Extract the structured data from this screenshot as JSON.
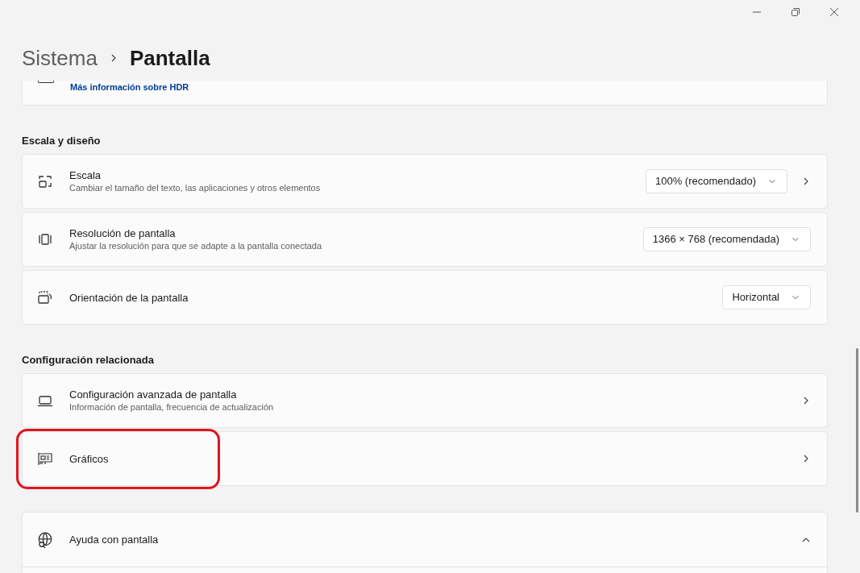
{
  "breadcrumb": {
    "parent": "Sistema",
    "current": "Pantalla"
  },
  "hdr_card": {
    "link": "Más información sobre HDR"
  },
  "sections": [
    {
      "heading": "Escala y diseño",
      "items": [
        {
          "kind": "dropdown",
          "title": "Escala",
          "subtitle": "Cambiar el tamaño del texto, las aplicaciones y otros elementos",
          "value": "100% (recomendado)",
          "chevron": true,
          "highlighted": false
        },
        {
          "kind": "dropdown",
          "title": "Resolución de pantalla",
          "subtitle": "Ajustar la resolución para que se adapte a la pantalla conectada",
          "value": "1366 × 768 (recomendada)",
          "chevron": false,
          "highlighted": false
        },
        {
          "kind": "dropdown",
          "title": "Orientación de la pantalla",
          "value": "Horizontal",
          "chevron": false,
          "highlighted": false
        }
      ]
    },
    {
      "heading": "Configuración relacionada",
      "items": [
        {
          "kind": "link",
          "title": "Configuración avanzada de pantalla",
          "subtitle": "Información de pantalla, frecuencia de actualización",
          "highlighted": false
        },
        {
          "kind": "link",
          "title": "Gráficos",
          "highlighted": true
        }
      ]
    }
  ],
  "help": {
    "title": "Ayuda con pantalla",
    "expanded": true
  }
}
